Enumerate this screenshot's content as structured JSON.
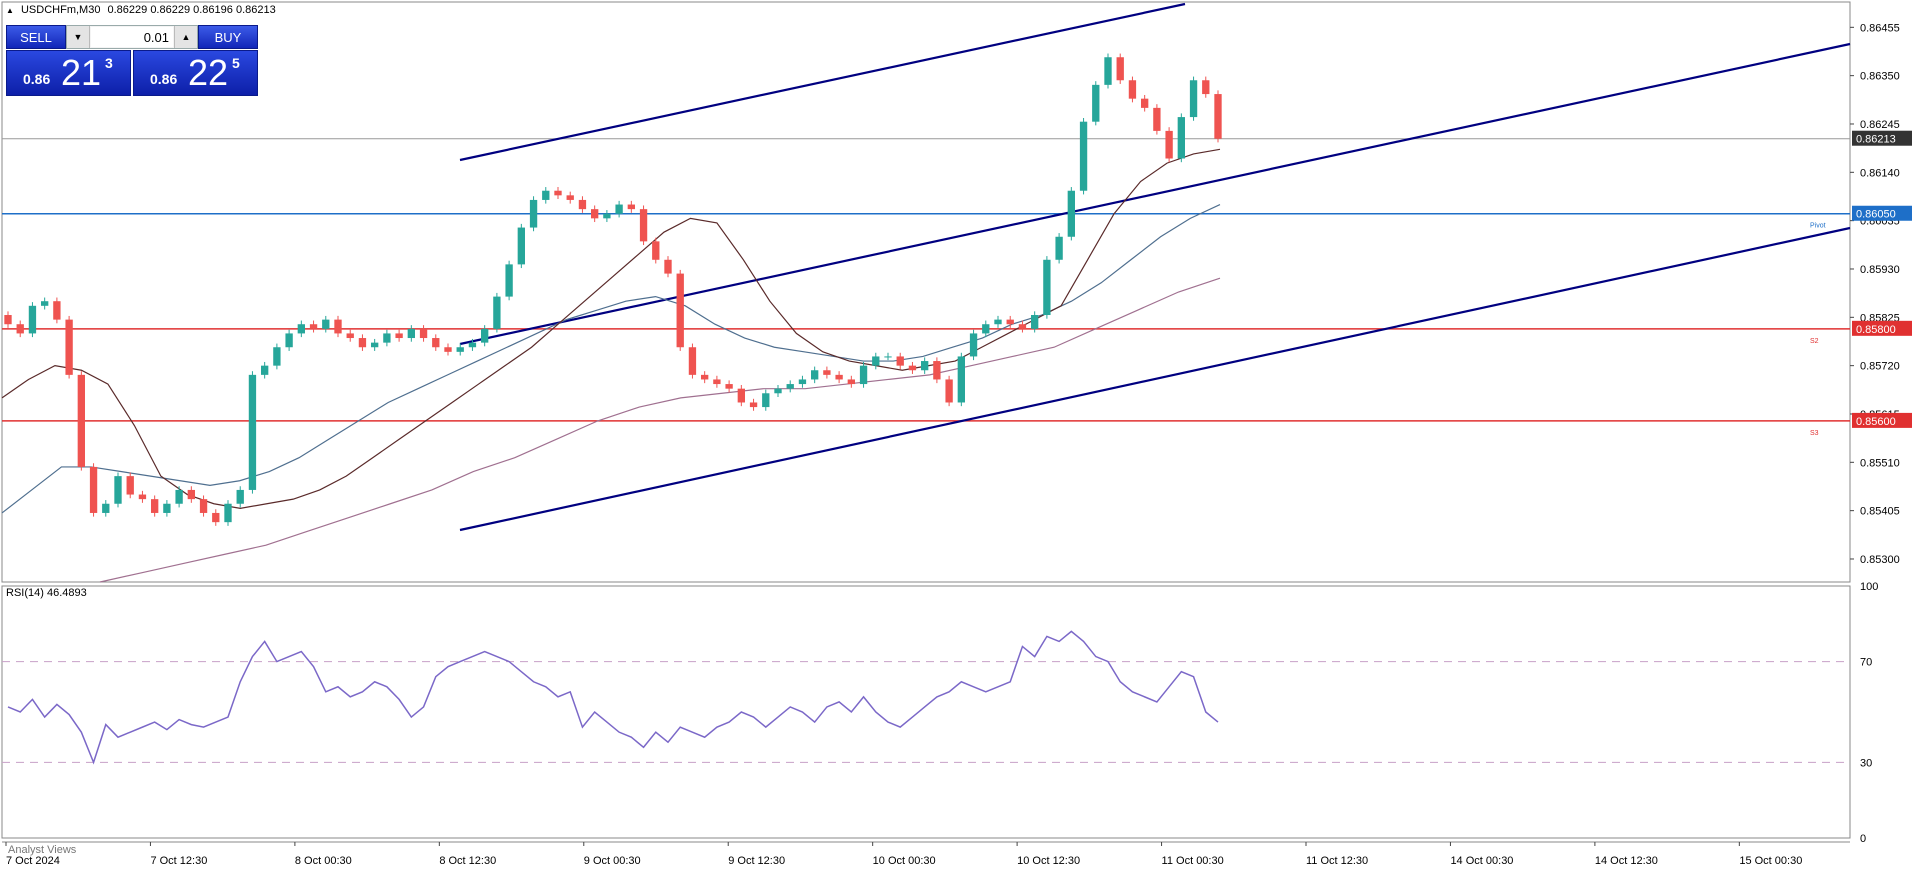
{
  "header": {
    "symbol_label": "USDCHFm,M30",
    "ohlc": "0.86229 0.86229 0.86196 0.86213"
  },
  "trade_panel": {
    "sell_label": "SELL",
    "buy_label": "BUY",
    "lot": "0.01",
    "sell_price_small": "0.86",
    "sell_price_big": "21",
    "sell_price_sup": "3",
    "buy_price_small": "0.86",
    "buy_price_big": "22",
    "buy_price_sup": "5"
  },
  "rsi_label": "RSI(14) 46.4893",
  "analyst_label": "Analyst Views",
  "colors": {
    "bull": "#26a69a",
    "bear": "#ef5350",
    "ma_fast": "#5a2a2a",
    "ma_mid": "#4f6f8f",
    "ma_slow": "#a07090",
    "channel": "#000080",
    "hline_pivot": "#1e6fc8",
    "hline_support": "#e03030",
    "rsi": "#7b68c8",
    "current_price_tag": "#333333"
  },
  "chart_data": [
    {
      "type": "candlestick",
      "ylim": [
        0.8525,
        0.8651
      ],
      "y_ticks": [
        "0.86455",
        "0.86350",
        "0.86245",
        "0.86140",
        "0.86035",
        "0.85930",
        "0.85825",
        "0.85720",
        "0.85615",
        "0.85510",
        "0.85405",
        "0.85300"
      ],
      "x_ticks": [
        "7 Oct 2024",
        "7 Oct 12:30",
        "8 Oct 00:30",
        "8 Oct 12:30",
        "9 Oct 00:30",
        "9 Oct 12:30",
        "10 Oct 00:30",
        "10 Oct 12:30",
        "11 Oct 00:30",
        "11 Oct 12:30",
        "14 Oct 00:30",
        "14 Oct 12:30",
        "15 Oct 00:30"
      ],
      "current_price": "0.86213",
      "horizontal_levels": [
        {
          "value": "0.86050",
          "label": "Pivot",
          "color_key": "hline_pivot"
        },
        {
          "value": "0.85800",
          "label": "S2",
          "color_key": "hline_support"
        },
        {
          "value": "0.85600",
          "label": "S3",
          "color_key": "hline_support"
        }
      ],
      "closes": [
        0.8581,
        0.8579,
        0.8585,
        0.8586,
        0.8582,
        0.857,
        0.855,
        0.854,
        0.8542,
        0.8548,
        0.8544,
        0.8543,
        0.854,
        0.8542,
        0.8545,
        0.8543,
        0.854,
        0.8538,
        0.8542,
        0.8545,
        0.857,
        0.8572,
        0.8576,
        0.8579,
        0.8581,
        0.858,
        0.8582,
        0.8579,
        0.8578,
        0.8576,
        0.8577,
        0.8579,
        0.8578,
        0.858,
        0.8578,
        0.8576,
        0.8575,
        0.8576,
        0.8577,
        0.858,
        0.8587,
        0.8594,
        0.8602,
        0.8608,
        0.861,
        0.8609,
        0.8608,
        0.8606,
        0.8604,
        0.8605,
        0.8607,
        0.8606,
        0.8599,
        0.8595,
        0.8592,
        0.8576,
        0.857,
        0.8569,
        0.8568,
        0.8567,
        0.8564,
        0.8563,
        0.8566,
        0.8567,
        0.8568,
        0.8569,
        0.8571,
        0.857,
        0.8569,
        0.8568,
        0.8572,
        0.8574,
        0.8574,
        0.8572,
        0.8571,
        0.8573,
        0.8569,
        0.8564,
        0.8574,
        0.8579,
        0.8581,
        0.8582,
        0.8581,
        0.858,
        0.8583,
        0.8595,
        0.86,
        0.861,
        0.8625,
        0.8633,
        0.8639,
        0.8634,
        0.863,
        0.8628,
        0.8623,
        0.8617,
        0.8626,
        0.8634,
        0.8631,
        0.86213
      ],
      "ma_fast": [
        0.8565,
        0.8569,
        0.8572,
        0.8571,
        0.8568,
        0.8559,
        0.8548,
        0.8544,
        0.8542,
        0.8541,
        0.8542,
        0.8543,
        0.8545,
        0.8548,
        0.8552,
        0.8556,
        0.856,
        0.8564,
        0.8568,
        0.8572,
        0.8576,
        0.8581,
        0.8586,
        0.8591,
        0.8596,
        0.8601,
        0.8604,
        0.8603,
        0.8595,
        0.8586,
        0.8579,
        0.8575,
        0.8573,
        0.8572,
        0.8571,
        0.8572,
        0.8573,
        0.8576,
        0.8579,
        0.8582,
        0.8585,
        0.8595,
        0.8605,
        0.8612,
        0.8616,
        0.8618,
        0.8619
      ],
      "ma_mid": [
        0.854,
        0.8545,
        0.855,
        0.855,
        0.8549,
        0.8548,
        0.8547,
        0.8546,
        0.8547,
        0.8549,
        0.8552,
        0.8556,
        0.856,
        0.8564,
        0.8567,
        0.857,
        0.8573,
        0.8576,
        0.8579,
        0.8582,
        0.8584,
        0.8586,
        0.8587,
        0.8585,
        0.8581,
        0.8578,
        0.8576,
        0.8575,
        0.8574,
        0.8573,
        0.8573,
        0.8574,
        0.8576,
        0.8578,
        0.8581,
        0.8583,
        0.8586,
        0.859,
        0.8595,
        0.86,
        0.8604,
        0.8607
      ],
      "ma_slow": [
        0.8525,
        0.8527,
        0.8529,
        0.8531,
        0.8533,
        0.8536,
        0.8539,
        0.8542,
        0.8545,
        0.8549,
        0.8552,
        0.8556,
        0.856,
        0.8563,
        0.8565,
        0.8566,
        0.8567,
        0.8567,
        0.8568,
        0.8569,
        0.857,
        0.8572,
        0.8574,
        0.8576,
        0.858,
        0.8584,
        0.8588,
        0.8591
      ]
    },
    {
      "type": "line",
      "name": "RSI(14)",
      "ylim": [
        0,
        100
      ],
      "y_ticks": [
        "100",
        "70",
        "30",
        "0"
      ],
      "levels": [
        70,
        30
      ],
      "values": [
        52,
        50,
        55,
        48,
        53,
        49,
        42,
        30,
        45,
        40,
        42,
        44,
        46,
        43,
        47,
        45,
        44,
        46,
        48,
        62,
        72,
        78,
        70,
        72,
        74,
        68,
        58,
        60,
        56,
        58,
        62,
        60,
        55,
        48,
        52,
        64,
        68,
        70,
        72,
        74,
        72,
        70,
        66,
        62,
        60,
        56,
        58,
        44,
        50,
        46,
        42,
        40,
        36,
        42,
        38,
        44,
        42,
        40,
        44,
        46,
        50,
        48,
        44,
        48,
        52,
        50,
        46,
        52,
        54,
        50,
        56,
        50,
        46,
        44,
        48,
        52,
        56,
        58,
        62,
        60,
        58,
        60,
        62,
        76,
        72,
        80,
        78,
        82,
        78,
        72,
        70,
        62,
        58,
        56,
        54,
        60,
        66,
        64,
        50,
        46
      ]
    }
  ]
}
